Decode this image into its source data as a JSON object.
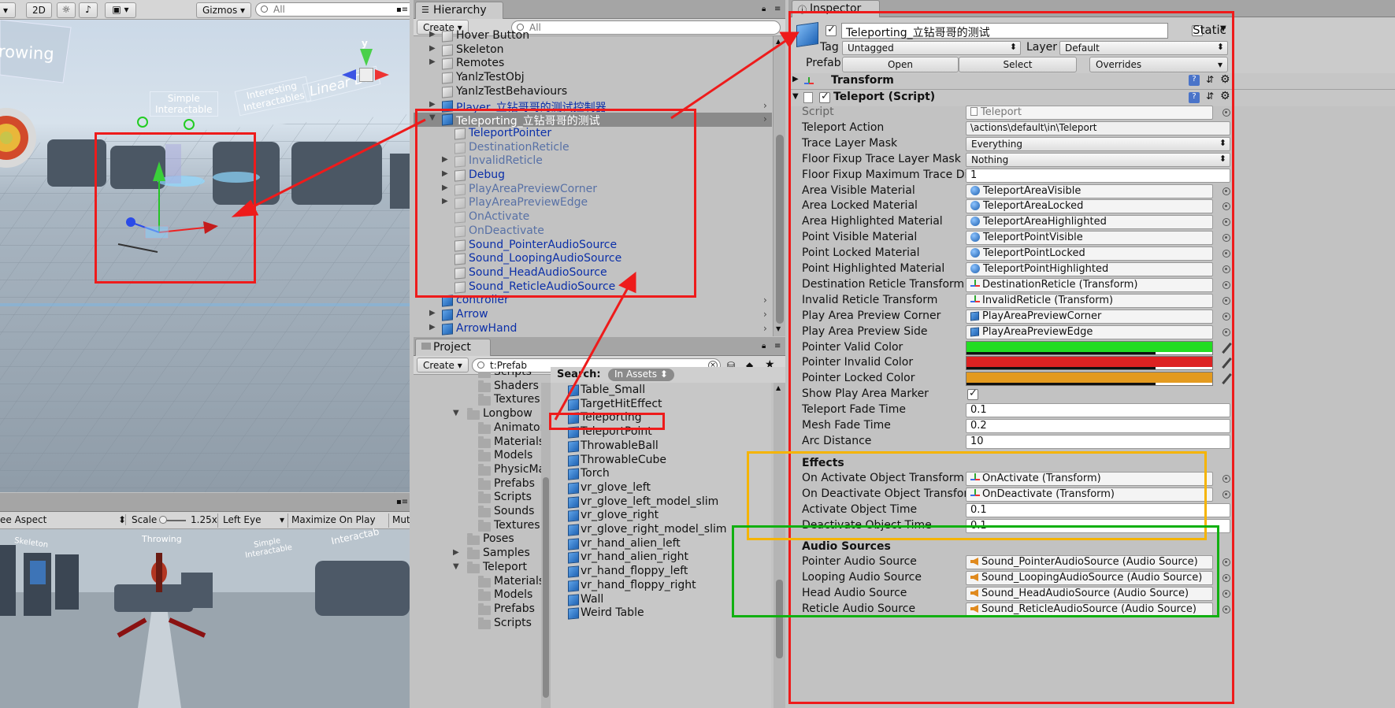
{
  "scene": {
    "toolbar": {
      "mode2d": "2D",
      "gizmos": "Gizmos",
      "search_placeholder": "All"
    },
    "overlay_text": {
      "throwing": "rowing",
      "simple": "Simple\nInteractable",
      "interesting": "Interesting\nInteractables",
      "linear": "Linear Dri"
    },
    "gizmo_axis_y": "y"
  },
  "game": {
    "toolbar": {
      "aspect": "ee Aspect",
      "scale_label": "Scale",
      "scale_value": "1.25x",
      "eye": "Left Eye",
      "maximize": "Maximize On Play",
      "mute": "Mute Audi"
    },
    "overlay_text": {
      "throwing": "Throwing",
      "simple": "Simple\nInteractable",
      "interactab": "Interactab",
      "skeleton": "Skeleton"
    }
  },
  "hierarchy": {
    "tab": "Hierarchy",
    "create": "Create",
    "search_placeholder": "All",
    "items": [
      {
        "label": "Hover Button",
        "indent": 0,
        "icon": "grey",
        "expand": true
      },
      {
        "label": "Skeleton",
        "indent": 0,
        "icon": "grey",
        "expand": true
      },
      {
        "label": "Remotes",
        "indent": 0,
        "icon": "grey",
        "expand": true
      },
      {
        "label": "YanlzTestObj",
        "indent": 0,
        "icon": "grey",
        "expand": false
      },
      {
        "label": "YanlzTestBehaviours",
        "indent": 0,
        "icon": "grey",
        "expand": false
      },
      {
        "label": "Player_立钻哥哥的测试控制器",
        "indent": 0,
        "icon": "blue",
        "expand": true,
        "prefab": true
      },
      {
        "label": "Teleporting_立钻哥哥的测试",
        "indent": 0,
        "icon": "blue",
        "expand": true,
        "open": true,
        "selected": true
      },
      {
        "label": "TeleportPointer",
        "indent": 1,
        "icon": "grey",
        "expand": false,
        "prefab": true
      },
      {
        "label": "DestinationReticle",
        "indent": 1,
        "icon": "grey",
        "expand": false,
        "faded": true
      },
      {
        "label": "InvalidReticle",
        "indent": 1,
        "icon": "grey",
        "expand": true,
        "faded": true
      },
      {
        "label": "Debug",
        "indent": 1,
        "icon": "grey",
        "expand": true,
        "prefab": true
      },
      {
        "label": "PlayAreaPreviewCorner",
        "indent": 1,
        "icon": "grey",
        "expand": true,
        "faded": true
      },
      {
        "label": "PlayAreaPreviewEdge",
        "indent": 1,
        "icon": "grey",
        "expand": true,
        "faded": true
      },
      {
        "label": "OnActivate",
        "indent": 1,
        "icon": "grey",
        "expand": false,
        "faded": true
      },
      {
        "label": "OnDeactivate",
        "indent": 1,
        "icon": "grey",
        "expand": false,
        "faded": true
      },
      {
        "label": "Sound_PointerAudioSource",
        "indent": 1,
        "icon": "grey",
        "expand": false,
        "prefab": true
      },
      {
        "label": "Sound_LoopingAudioSource",
        "indent": 1,
        "icon": "grey",
        "expand": false,
        "prefab": true
      },
      {
        "label": "Sound_HeadAudioSource",
        "indent": 1,
        "icon": "grey",
        "expand": false,
        "prefab": true
      },
      {
        "label": "Sound_ReticleAudioSource",
        "indent": 1,
        "icon": "grey",
        "expand": false,
        "prefab": true
      },
      {
        "label": "controller",
        "indent": 0,
        "icon": "blue",
        "expand": false,
        "prefab": true
      },
      {
        "label": "Arrow",
        "indent": 0,
        "icon": "blue",
        "expand": true,
        "prefab": true
      },
      {
        "label": "ArrowHand",
        "indent": 0,
        "icon": "blue",
        "expand": true,
        "prefab": true
      }
    ]
  },
  "project": {
    "tab": "Project",
    "create": "Create",
    "search_value": "t:Prefab",
    "search_label": "Search:",
    "scope": "In Assets",
    "tree": [
      {
        "label": "Scripts",
        "indent": 2,
        "partial": true
      },
      {
        "label": "Shaders",
        "indent": 2
      },
      {
        "label": "Textures",
        "indent": 2
      },
      {
        "label": "Longbow",
        "indent": 1,
        "open": true
      },
      {
        "label": "Animator:",
        "indent": 2
      },
      {
        "label": "Materials",
        "indent": 2
      },
      {
        "label": "Models",
        "indent": 2
      },
      {
        "label": "PhysicMat",
        "indent": 2
      },
      {
        "label": "Prefabs",
        "indent": 2
      },
      {
        "label": "Scripts",
        "indent": 2
      },
      {
        "label": "Sounds",
        "indent": 2
      },
      {
        "label": "Textures",
        "indent": 2
      },
      {
        "label": "Poses",
        "indent": 1
      },
      {
        "label": "Samples",
        "indent": 1,
        "closed": true
      },
      {
        "label": "Teleport",
        "indent": 1,
        "open": true
      },
      {
        "label": "Materials",
        "indent": 2
      },
      {
        "label": "Models",
        "indent": 2
      },
      {
        "label": "Prefabs",
        "indent": 2
      },
      {
        "label": "Scripts",
        "indent": 2
      }
    ],
    "results": [
      "Table_Small",
      "TargetHitEffect",
      "Teleporting",
      "TeleportPoint",
      "ThrowableBall",
      "ThrowableCube",
      "Torch",
      "vr_glove_left",
      "vr_glove_left_model_slim",
      "vr_glove_right",
      "vr_glove_right_model_slim",
      "vr_hand_alien_left",
      "vr_hand_alien_right",
      "vr_hand_floppy_left",
      "vr_hand_floppy_right",
      "Wall",
      "Weird Table"
    ]
  },
  "inspector": {
    "tab": "Inspector",
    "object_name": "Teleporting_立钻哥哥的测试",
    "static_label": "Static",
    "tag_label": "Tag",
    "tag_value": "Untagged",
    "layer_label": "Layer",
    "layer_value": "Default",
    "prefab_label": "Prefab",
    "prefab_open": "Open",
    "prefab_select": "Select",
    "prefab_overrides": "Overrides",
    "transform_title": "Transform",
    "script_title": "Teleport (Script)",
    "fields": [
      {
        "label": "Script",
        "value": "Teleport",
        "kind": "script"
      },
      {
        "label": "Teleport Action",
        "value": "\\actions\\default\\in\\Teleport",
        "kind": "text"
      },
      {
        "label": "Trace Layer Mask",
        "value": "Everything",
        "kind": "select"
      },
      {
        "label": "Floor Fixup Trace Layer Mask",
        "value": "Nothing",
        "kind": "select"
      },
      {
        "label": "Floor Fixup Maximum Trace Dista",
        "value": "1",
        "kind": "num"
      },
      {
        "label": "Area Visible Material",
        "value": "TeleportAreaVisible",
        "kind": "mat"
      },
      {
        "label": "Area Locked Material",
        "value": "TeleportAreaLocked",
        "kind": "mat"
      },
      {
        "label": "Area Highlighted Material",
        "value": "TeleportAreaHighlighted",
        "kind": "mat"
      },
      {
        "label": "Point Visible Material",
        "value": "TeleportPointVisible",
        "kind": "mat"
      },
      {
        "label": "Point Locked Material",
        "value": "TeleportPointLocked",
        "kind": "mat"
      },
      {
        "label": "Point Highlighted Material",
        "value": "TeleportPointHighlighted",
        "kind": "mat"
      },
      {
        "label": "Destination Reticle Transform",
        "value": "DestinationReticle (Transform)",
        "kind": "tfm"
      },
      {
        "label": "Invalid Reticle Transform",
        "value": "InvalidReticle (Transform)",
        "kind": "tfm"
      },
      {
        "label": "Play Area Preview Corner",
        "value": "PlayAreaPreviewCorner",
        "kind": "go"
      },
      {
        "label": "Play Area Preview Side",
        "value": "PlayAreaPreviewEdge",
        "kind": "go"
      },
      {
        "label": "Pointer Valid Color",
        "value": "#22dd22",
        "kind": "color"
      },
      {
        "label": "Pointer Invalid Color",
        "value": "#dd2222",
        "kind": "color"
      },
      {
        "label": "Pointer Locked Color",
        "value": "#e39a1f",
        "kind": "color"
      },
      {
        "label": "Show Play Area Marker",
        "value": "true",
        "kind": "check"
      },
      {
        "label": "Teleport Fade Time",
        "value": "0.1",
        "kind": "num"
      },
      {
        "label": "Mesh Fade Time",
        "value": "0.2",
        "kind": "num"
      },
      {
        "label": "Arc Distance",
        "value": "10",
        "kind": "num"
      }
    ],
    "effects_header": "Effects",
    "effects": [
      {
        "label": "On Activate Object Transform",
        "value": "OnActivate (Transform)",
        "kind": "tfm"
      },
      {
        "label": "On Deactivate Object Transform",
        "value": "OnDeactivate (Transform)",
        "kind": "tfm"
      },
      {
        "label": "Activate Object Time",
        "value": "0.1",
        "kind": "num"
      },
      {
        "label": "Deactivate Object Time",
        "value": "0.1",
        "kind": "num"
      }
    ],
    "audio_header": "Audio Sources",
    "audio": [
      {
        "label": "Pointer Audio Source",
        "value": "Sound_PointerAudioSource (Audio Source)",
        "kind": "audio"
      },
      {
        "label": "Looping Audio Source",
        "value": "Sound_LoopingAudioSource (Audio Source)",
        "kind": "audio"
      },
      {
        "label": "Head Audio Source",
        "value": "Sound_HeadAudioSource (Audio Source)",
        "kind": "audio"
      },
      {
        "label": "Reticle Audio Source",
        "value": "Sound_ReticleAudioSource (Audio Source)",
        "kind": "audio"
      }
    ]
  },
  "colors": {
    "annotation_red": "#ee1b1b",
    "annotation_orange": "#f5b400",
    "annotation_green": "#11b011",
    "selection": "#8a8a8a",
    "prefab_blue": "#0b2fa8"
  }
}
